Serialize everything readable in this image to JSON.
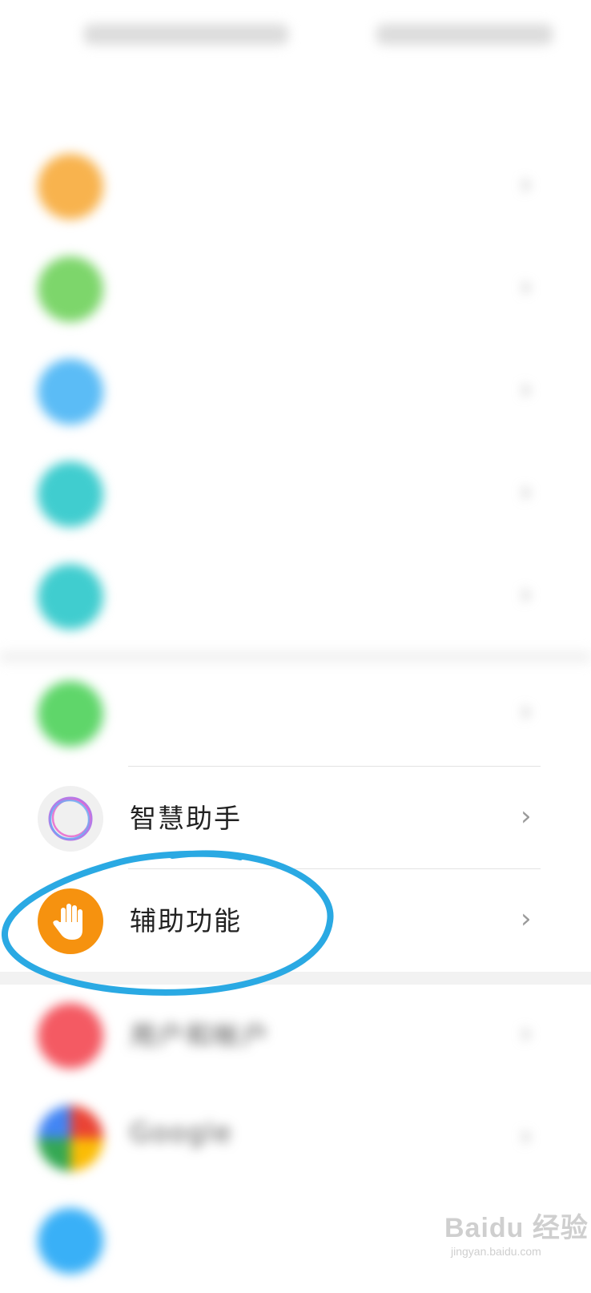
{
  "statusbar": {
    "left_placeholder": "",
    "right_placeholder": ""
  },
  "header": {
    "title": ""
  },
  "items": [
    {
      "label": "",
      "color": "#f8b34e",
      "blurred": true
    },
    {
      "label": "",
      "color": "#7dd66b",
      "blurred": true
    },
    {
      "label": "",
      "color": "#5bbcf6",
      "blurred": true
    },
    {
      "label": "",
      "color": "#40cdcf",
      "blurred": true
    },
    {
      "label": "",
      "color": "#40cdcf",
      "blurred": true
    },
    {
      "label": "",
      "color": "#5fd66a",
      "blurred": true
    },
    {
      "label": "智慧助手",
      "icon": "smart-assistant-ring-icon",
      "blurred": false
    },
    {
      "label": "辅助功能",
      "icon": "hand-icon",
      "color": "#f6920f",
      "blurred": false
    },
    {
      "label": "用户和帐户",
      "color": "#f45a63",
      "blurred": true
    },
    {
      "label": "Google",
      "icon": "google-icon",
      "blurred": true
    },
    {
      "label": "",
      "color": "#39b0f7",
      "blurred": true
    }
  ],
  "chevron": "›",
  "annotation": {
    "color": "#2aa9e3"
  },
  "watermark": {
    "main": "Baidu 经验",
    "sub": "jingyan.baidu.com"
  }
}
